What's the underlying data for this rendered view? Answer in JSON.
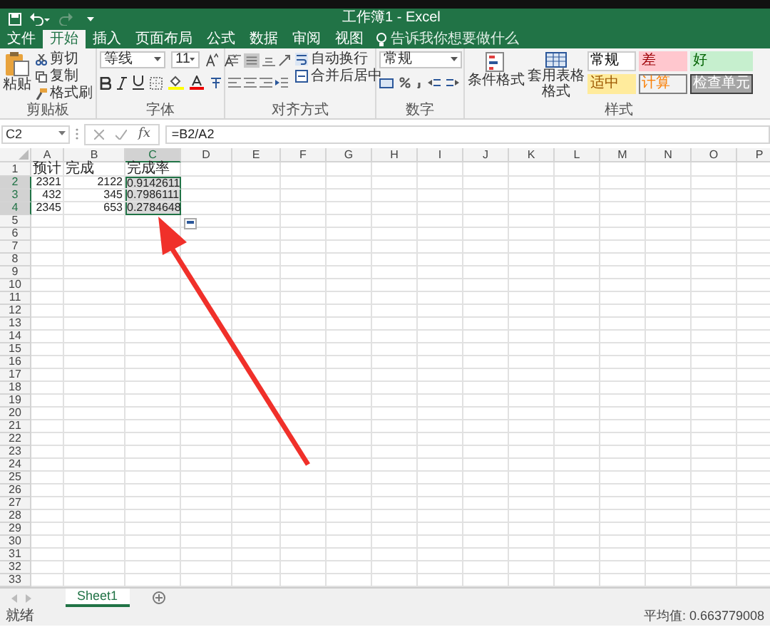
{
  "window": {
    "title": "工作簿1 - Excel"
  },
  "tabs": [
    {
      "label": "文件",
      "selected": false
    },
    {
      "label": "开始",
      "selected": true
    },
    {
      "label": "插入",
      "selected": false
    },
    {
      "label": "页面布局",
      "selected": false
    },
    {
      "label": "公式",
      "selected": false
    },
    {
      "label": "数据",
      "selected": false
    },
    {
      "label": "审阅",
      "selected": false
    },
    {
      "label": "视图",
      "selected": false
    }
  ],
  "tell_me": {
    "placeholder": "告诉我你想要做什么"
  },
  "ribbon": {
    "clipboard": {
      "paste": "粘贴",
      "cut": "剪切",
      "copy": "复制",
      "format_painter": "格式刷",
      "label": "剪贴板"
    },
    "font": {
      "name": "等线",
      "size": "11",
      "label": "字体"
    },
    "alignment": {
      "wrap": "自动换行",
      "merge": "合并后居中",
      "label": "对齐方式"
    },
    "number": {
      "format": "常规",
      "label": "数字"
    },
    "styles": {
      "conditional": "条件格式",
      "table": "套用表格格式",
      "cells": [
        {
          "text": "常规",
          "kind": "normal"
        },
        {
          "text": "差",
          "kind": "bad"
        },
        {
          "text": "好",
          "kind": "good"
        },
        {
          "text": "适中",
          "kind": "neutral"
        },
        {
          "text": "计算",
          "kind": "calculation"
        },
        {
          "text": "检查单元",
          "kind": "check"
        }
      ],
      "label": "样式"
    }
  },
  "formula_bar": {
    "name_box": "C2",
    "fx": "fx",
    "formula": "=B2/A2"
  },
  "sheet": {
    "columns": [
      {
        "letter": "A",
        "selected": false
      },
      {
        "letter": "B",
        "selected": false
      },
      {
        "letter": "C",
        "selected": true
      },
      {
        "letter": "D",
        "selected": false
      },
      {
        "letter": "E",
        "selected": false
      },
      {
        "letter": "F",
        "selected": false
      },
      {
        "letter": "G",
        "selected": false
      },
      {
        "letter": "H",
        "selected": false
      },
      {
        "letter": "I",
        "selected": false
      },
      {
        "letter": "J",
        "selected": false
      },
      {
        "letter": "K",
        "selected": false
      },
      {
        "letter": "L",
        "selected": false
      },
      {
        "letter": "M",
        "selected": false
      },
      {
        "letter": "N",
        "selected": false
      },
      {
        "letter": "O",
        "selected": false
      },
      {
        "letter": "P",
        "selected": false
      }
    ],
    "rows": [
      {
        "number": "1",
        "selected": false,
        "cells": {
          "A": {
            "text": "预计",
            "kind": "text",
            "selected": false
          },
          "B": {
            "text": "完成",
            "kind": "text",
            "selected": false
          },
          "C": {
            "text": "完成率",
            "kind": "text",
            "selected": false
          }
        }
      },
      {
        "number": "2",
        "selected": true,
        "cells": {
          "A": {
            "text": "2321",
            "kind": "number",
            "selected": false
          },
          "B": {
            "text": "2122",
            "kind": "number",
            "selected": false
          },
          "C": {
            "text": "0.9142611",
            "kind": "number",
            "selected": true
          }
        }
      },
      {
        "number": "3",
        "selected": true,
        "cells": {
          "A": {
            "text": "432",
            "kind": "number",
            "selected": false
          },
          "B": {
            "text": "345",
            "kind": "number",
            "selected": false
          },
          "C": {
            "text": "0.7986111",
            "kind": "number",
            "selected": true
          }
        }
      },
      {
        "number": "4",
        "selected": true,
        "cells": {
          "A": {
            "text": "2345",
            "kind": "number",
            "selected": false
          },
          "B": {
            "text": "653",
            "kind": "number",
            "selected": false
          },
          "C": {
            "text": "0.2784648",
            "kind": "number",
            "selected": true
          }
        }
      },
      {
        "number": "5",
        "selected": false
      },
      {
        "number": "6",
        "selected": false
      },
      {
        "number": "7",
        "selected": false
      },
      {
        "number": "8",
        "selected": false
      },
      {
        "number": "9",
        "selected": false
      },
      {
        "number": "10",
        "selected": false
      },
      {
        "number": "11",
        "selected": false
      },
      {
        "number": "12",
        "selected": false
      },
      {
        "number": "13",
        "selected": false
      },
      {
        "number": "14",
        "selected": false
      },
      {
        "number": "15",
        "selected": false
      },
      {
        "number": "16",
        "selected": false
      },
      {
        "number": "17",
        "selected": false
      },
      {
        "number": "18",
        "selected": false
      },
      {
        "number": "19",
        "selected": false
      },
      {
        "number": "20",
        "selected": false
      },
      {
        "number": "21",
        "selected": false
      },
      {
        "number": "22",
        "selected": false
      },
      {
        "number": "23",
        "selected": false
      },
      {
        "number": "24",
        "selected": false
      },
      {
        "number": "25",
        "selected": false
      },
      {
        "number": "26",
        "selected": false
      },
      {
        "number": "27",
        "selected": false
      },
      {
        "number": "28",
        "selected": false
      },
      {
        "number": "29",
        "selected": false
      },
      {
        "number": "30",
        "selected": false
      },
      {
        "number": "31",
        "selected": false
      },
      {
        "number": "32",
        "selected": false
      },
      {
        "number": "33",
        "selected": false
      }
    ]
  },
  "sheet_tabs": [
    {
      "label": "Sheet1",
      "selected": true
    }
  ],
  "status_bar": {
    "status": "就绪",
    "average": "平均值: 0.663779008"
  }
}
